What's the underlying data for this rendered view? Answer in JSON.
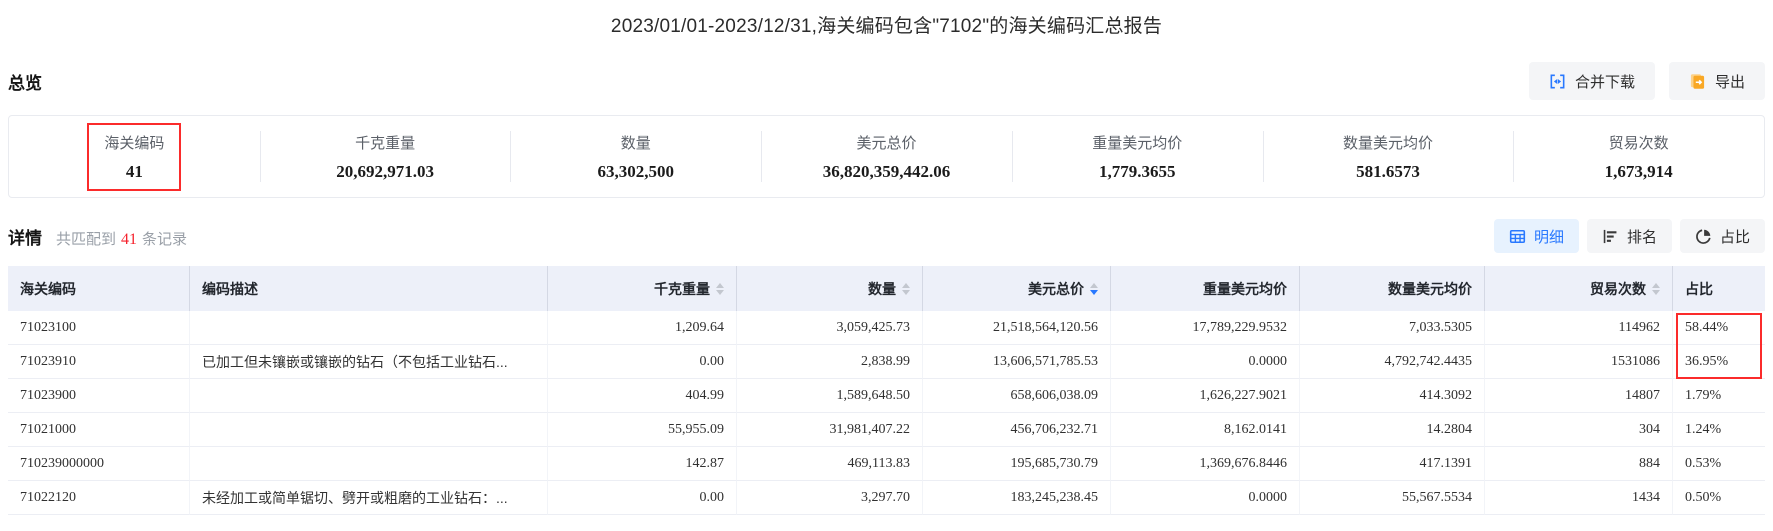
{
  "title": "2023/01/01-2023/12/31,海关编码包含\"7102\"的海关编码汇总报告",
  "colors": {
    "accent_blue": "#2878ff",
    "active_button_bg": "#e7f2fe",
    "button_bg": "#f4f5f7",
    "export_orange": "#f9a825",
    "count_red": "#f5222d",
    "annotation_red": "#fb2b2b",
    "table_header_bg": "#edf0f9"
  },
  "icons": {
    "merge_download": "merge-cells-icon",
    "export": "export-file-icon",
    "detail_view": "table-grid-icon",
    "rank_view": "ranking-bars-icon",
    "share_view": "pie-chart-icon",
    "sort": "caret-up-down-icons"
  },
  "overview": {
    "heading": "总览",
    "merge_download_label": "合并下载",
    "export_label": "导出",
    "cards": [
      {
        "name": "customs-code",
        "label": "海关编码",
        "value": "41",
        "highlighted": true
      },
      {
        "name": "kg-weight",
        "label": "千克重量",
        "value": "20,692,971.03",
        "highlighted": false
      },
      {
        "name": "quantity",
        "label": "数量",
        "value": "63,302,500",
        "highlighted": false
      },
      {
        "name": "usd-total",
        "label": "美元总价",
        "value": "36,820,359,442.06",
        "highlighted": false
      },
      {
        "name": "usd-per-weight",
        "label": "重量美元均价",
        "value": "1,779.3655",
        "highlighted": false
      },
      {
        "name": "usd-per-qty",
        "label": "数量美元均价",
        "value": "581.6573",
        "highlighted": false
      },
      {
        "name": "trade-count",
        "label": "贸易次数",
        "value": "1,673,914",
        "highlighted": false
      }
    ]
  },
  "details": {
    "heading": "详情",
    "match_prefix": "共匹配到",
    "match_count": "41",
    "match_suffix": "条记录",
    "view_buttons": [
      {
        "label": "明细",
        "active": true
      },
      {
        "label": "排名",
        "active": false
      },
      {
        "label": "占比",
        "active": false
      }
    ]
  },
  "table": {
    "columns": [
      {
        "key": "hs-code",
        "label": "海关编码",
        "align": "left",
        "sortable": false,
        "sort": null
      },
      {
        "key": "description",
        "label": "编码描述",
        "align": "left",
        "sortable": false,
        "sort": null
      },
      {
        "key": "kg-weight",
        "label": "千克重量",
        "align": "right",
        "sortable": true,
        "sort": null
      },
      {
        "key": "quantity",
        "label": "数量",
        "align": "right",
        "sortable": true,
        "sort": null
      },
      {
        "key": "usd-total",
        "label": "美元总价",
        "align": "right",
        "sortable": true,
        "sort": "desc"
      },
      {
        "key": "usd-per-weight",
        "label": "重量美元均价",
        "align": "right",
        "sortable": false,
        "sort": null
      },
      {
        "key": "usd-per-qty",
        "label": "数量美元均价",
        "align": "right",
        "sortable": false,
        "sort": null
      },
      {
        "key": "trade-count",
        "label": "贸易次数",
        "align": "right",
        "sortable": true,
        "sort": null
      },
      {
        "key": "share",
        "label": "占比",
        "align": "left",
        "sortable": false,
        "sort": null
      }
    ],
    "rows": [
      [
        "71023100",
        "",
        "1,209.64",
        "3,059,425.73",
        "21,518,564,120.56",
        "17,789,229.9532",
        "7,033.5305",
        "114962",
        "58.44%"
      ],
      [
        "71023910",
        "已加工但未镶嵌或镶嵌的钻石（不包括工业钻石...",
        "0.00",
        "2,838.99",
        "13,606,571,785.53",
        "0.0000",
        "4,792,742.4435",
        "1531086",
        "36.95%"
      ],
      [
        "71023900",
        "",
        "404.99",
        "1,589,648.50",
        "658,606,038.09",
        "1,626,227.9021",
        "414.3092",
        "14807",
        "1.79%"
      ],
      [
        "71021000",
        "",
        "55,955.09",
        "31,981,407.22",
        "456,706,232.71",
        "8,162.0141",
        "14.2804",
        "304",
        "1.24%"
      ],
      [
        "710239000000",
        "",
        "142.87",
        "469,113.83",
        "195,685,730.79",
        "1,369,676.8446",
        "417.1391",
        "884",
        "0.53%"
      ],
      [
        "71022120",
        "未经加工或简单锯切、劈开或粗磨的工业钻石：...",
        "0.00",
        "3,297.70",
        "183,245,238.45",
        "0.0000",
        "55,567.5534",
        "1434",
        "0.50%"
      ]
    ]
  }
}
